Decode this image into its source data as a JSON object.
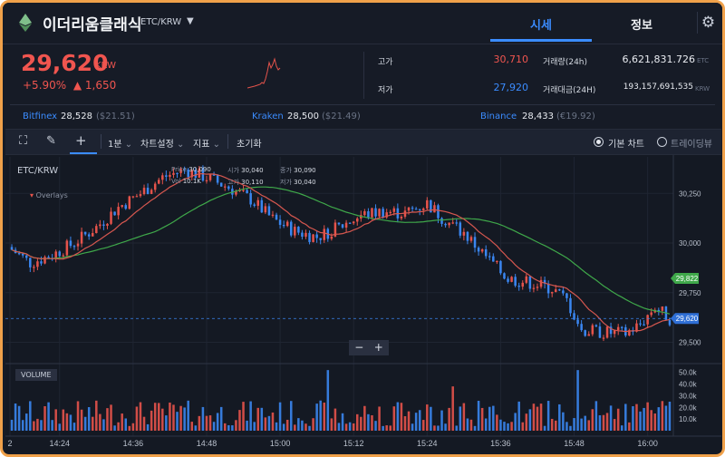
{
  "header": {
    "coin_name": "이더리움클래식",
    "pair": "ETC/KRW",
    "tabs": [
      {
        "label": "시세",
        "active": true
      },
      {
        "label": "정보",
        "active": false
      }
    ]
  },
  "price": {
    "current": "29,620",
    "unit": "KRW",
    "change_pct": "+5.90%",
    "change_abs": "▲ 1,650",
    "color": "#f0554f"
  },
  "stats": {
    "high_label": "고가",
    "high": "30,710",
    "low_label": "저가",
    "low": "27,920",
    "volume_label": "거래량(24h)",
    "volume": "6,621,831.726",
    "volume_unit": "ETC",
    "amount_label": "거래대금(24H)",
    "amount": "193,157,691,535",
    "amount_unit": "KRW"
  },
  "exchanges": [
    {
      "name": "Bitfinex",
      "price": "28,528",
      "sub": "($21.51)"
    },
    {
      "name": "Kraken",
      "price": "28,500",
      "sub": "($21.49)"
    },
    {
      "name": "Binance",
      "price": "28,433",
      "sub": "(€19.92)"
    }
  ],
  "toolbar": {
    "interval": "1분",
    "chart_settings": "차트설정",
    "indicators": "지표",
    "reset": "초기화",
    "basic_chart": "기본 차트",
    "trading_view": "트레이딩뷰"
  },
  "chart_header": {
    "title": "ETC/KRW",
    "overlays": "Overlays",
    "ohlc": [
      {
        "label": "Price",
        "value": "30,090"
      },
      {
        "label": "시가",
        "value": "30,040"
      },
      {
        "label": "종가",
        "value": "30,090"
      },
      {
        "label": "Vol",
        "value": "10.1K"
      },
      {
        "label": "고가",
        "value": "30,110"
      },
      {
        "label": "저가",
        "value": "30,040"
      }
    ],
    "volume_label": "VOLUME",
    "zoom_out": "−",
    "zoom_in": "+"
  },
  "chart_data": {
    "type": "candlestick",
    "y_ticks": [
      "30,250",
      "30,000",
      "29,750",
      "29,500"
    ],
    "y_tick_values": [
      30250,
      30000,
      29750,
      29500
    ],
    "ylim": [
      29420,
      30425
    ],
    "vol_ticks": [
      "50.0k",
      "40.0k",
      "30.0k",
      "20.0k",
      "10.0k"
    ],
    "vol_tick_values": [
      50000,
      40000,
      30000,
      20000,
      10000
    ],
    "vol_max": 56000,
    "x_ticks": [
      "2",
      "14:24",
      "14:36",
      "14:48",
      "15:00",
      "15:12",
      "15:24",
      "15:36",
      "15:48",
      "16:00"
    ],
    "x_tick_index": [
      -1,
      13,
      33,
      53,
      73,
      93,
      113,
      133,
      153,
      173
    ],
    "ma_green_label": "29,822",
    "ma_green_last": 29822,
    "price_label": "29,620",
    "price_last": 29620,
    "colors": {
      "up": "#e5534b",
      "down": "#3a86f0",
      "ma_green": "#3fa84a",
      "ma_red": "#d6574f"
    }
  }
}
